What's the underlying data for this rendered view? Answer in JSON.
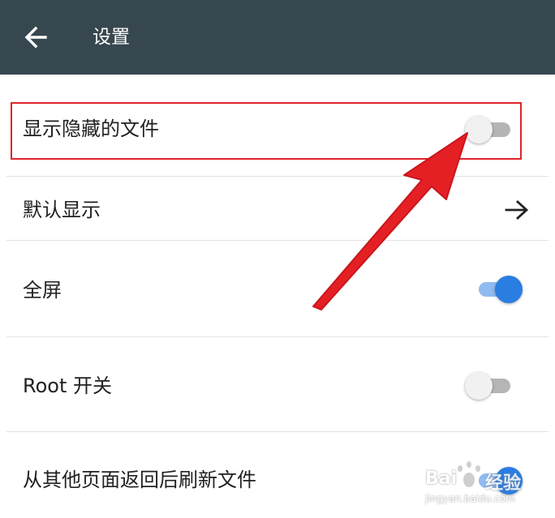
{
  "appbar": {
    "back_icon": "arrow-back-icon",
    "title": "设置"
  },
  "settings": [
    {
      "label": "显示隐藏的文件",
      "control": "switch",
      "checked": false,
      "highlighted": true
    },
    {
      "label": "默认显示",
      "control": "arrow",
      "icon": "arrow-forward-icon"
    },
    {
      "label": "全屏",
      "control": "switch",
      "checked": true
    },
    {
      "label": "Root 开关",
      "control": "switch",
      "checked": false
    },
    {
      "label": "从其他页面返回后刷新文件",
      "control": "switch",
      "checked": true
    }
  ],
  "annotation": {
    "highlight_color": "#e0242b",
    "pointer_icon": "red-pointer-arrow"
  },
  "watermark": {
    "logo": "baidu-paw-logo",
    "brand": "Bai",
    "brand_suffix": "经验",
    "url": "jingyan.baidu.com"
  },
  "colors": {
    "appbar": "#37474f",
    "accent": "#2a7de1",
    "accent_track": "#8fbbf2",
    "off_track": "#b5b5b5"
  }
}
